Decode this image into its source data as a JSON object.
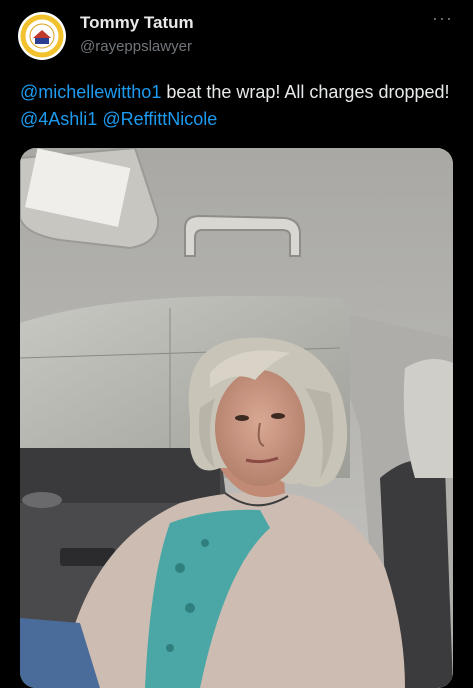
{
  "author": {
    "display_name": "Tommy Tatum",
    "handle": "@rayeppslawyer",
    "avatar_text_top": "BRING OUR DEMS",
    "avatar_text_bottom": "HOME"
  },
  "more_icon": "more-horizontal-icon",
  "tweet": {
    "mention_1": "@michellewittho1",
    "text_1": " beat the wrap! All charges dropped! ",
    "mention_2": "@4Ashli1",
    "space": " ",
    "mention_3": "@ReffittNicole"
  },
  "colors": {
    "background": "#000000",
    "text": "#e7e9ea",
    "secondary": "#71767b",
    "link": "#1d9bf0",
    "avatar_ring": "#f2c12e"
  },
  "media": {
    "kind": "photo",
    "description_icon": "car-selfie-photo"
  }
}
